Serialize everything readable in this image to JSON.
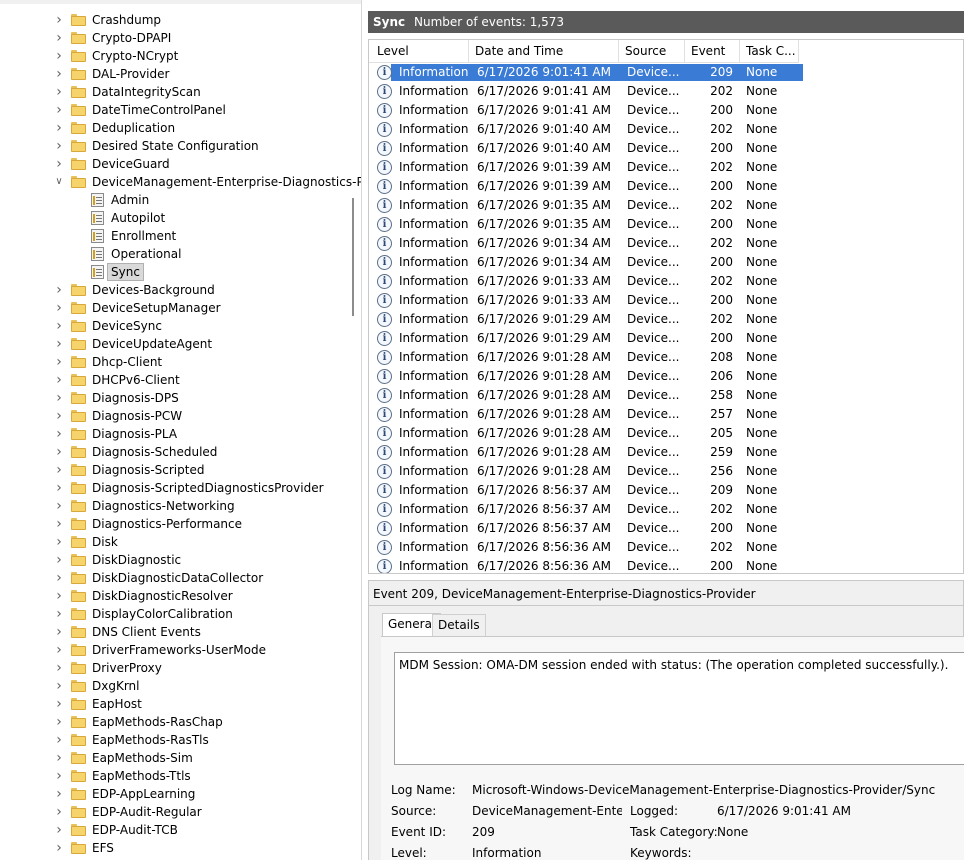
{
  "tree": {
    "items": [
      {
        "label": "Crashdump",
        "expanded": false
      },
      {
        "label": "Crypto-DPAPI",
        "expanded": false
      },
      {
        "label": "Crypto-NCrypt",
        "expanded": false
      },
      {
        "label": "DAL-Provider",
        "expanded": false
      },
      {
        "label": "DataIntegrityScan",
        "expanded": false
      },
      {
        "label": "DateTimeControlPanel",
        "expanded": false
      },
      {
        "label": "Deduplication",
        "expanded": false
      },
      {
        "label": "Desired State Configuration",
        "expanded": false
      },
      {
        "label": "DeviceGuard",
        "expanded": false
      },
      {
        "label": "DeviceManagement-Enterprise-Diagnostics-Pro",
        "expanded": true
      },
      {
        "label": "Devices-Background",
        "expanded": false
      },
      {
        "label": "DeviceSetupManager",
        "expanded": false
      },
      {
        "label": "DeviceSync",
        "expanded": false
      },
      {
        "label": "DeviceUpdateAgent",
        "expanded": false
      },
      {
        "label": "Dhcp-Client",
        "expanded": false
      },
      {
        "label": "DHCPv6-Client",
        "expanded": false
      },
      {
        "label": "Diagnosis-DPS",
        "expanded": false
      },
      {
        "label": "Diagnosis-PCW",
        "expanded": false
      },
      {
        "label": "Diagnosis-PLA",
        "expanded": false
      },
      {
        "label": "Diagnosis-Scheduled",
        "expanded": false
      },
      {
        "label": "Diagnosis-Scripted",
        "expanded": false
      },
      {
        "label": "Diagnosis-ScriptedDiagnosticsProvider",
        "expanded": false
      },
      {
        "label": "Diagnostics-Networking",
        "expanded": false
      },
      {
        "label": "Diagnostics-Performance",
        "expanded": false
      },
      {
        "label": "Disk",
        "expanded": false
      },
      {
        "label": "DiskDiagnostic",
        "expanded": false
      },
      {
        "label": "DiskDiagnosticDataCollector",
        "expanded": false
      },
      {
        "label": "DiskDiagnosticResolver",
        "expanded": false
      },
      {
        "label": "DisplayColorCalibration",
        "expanded": false
      },
      {
        "label": "DNS Client Events",
        "expanded": false
      },
      {
        "label": "DriverFrameworks-UserMode",
        "expanded": false
      },
      {
        "label": "DriverProxy",
        "expanded": false
      },
      {
        "label": "DxgKrnl",
        "expanded": false
      },
      {
        "label": "EapHost",
        "expanded": false
      },
      {
        "label": "EapMethods-RasChap",
        "expanded": false
      },
      {
        "label": "EapMethods-RasTls",
        "expanded": false
      },
      {
        "label": "EapMethods-Sim",
        "expanded": false
      },
      {
        "label": "EapMethods-Ttls",
        "expanded": false
      },
      {
        "label": "EDP-AppLearning",
        "expanded": false
      },
      {
        "label": "EDP-Audit-Regular",
        "expanded": false
      },
      {
        "label": "EDP-Audit-TCB",
        "expanded": false
      },
      {
        "label": "EFS",
        "expanded": false
      }
    ],
    "children": [
      "Admin",
      "Autopilot",
      "Enrollment",
      "Operational",
      "Sync"
    ],
    "selected_child": "Sync"
  },
  "header": {
    "title": "Sync",
    "count": "Number of events: 1,573"
  },
  "grid": {
    "columns": [
      "Level",
      "Date and Time",
      "Source",
      "Event ID",
      "Task C..."
    ],
    "rows": [
      [
        "Information",
        "6/17/2026 9:01:41 AM",
        "Device...",
        "209",
        "None"
      ],
      [
        "Information",
        "6/17/2026 9:01:41 AM",
        "Device...",
        "202",
        "None"
      ],
      [
        "Information",
        "6/17/2026 9:01:41 AM",
        "Device...",
        "200",
        "None"
      ],
      [
        "Information",
        "6/17/2026 9:01:40 AM",
        "Device...",
        "202",
        "None"
      ],
      [
        "Information",
        "6/17/2026 9:01:40 AM",
        "Device...",
        "200",
        "None"
      ],
      [
        "Information",
        "6/17/2026 9:01:39 AM",
        "Device...",
        "202",
        "None"
      ],
      [
        "Information",
        "6/17/2026 9:01:39 AM",
        "Device...",
        "200",
        "None"
      ],
      [
        "Information",
        "6/17/2026 9:01:35 AM",
        "Device...",
        "202",
        "None"
      ],
      [
        "Information",
        "6/17/2026 9:01:35 AM",
        "Device...",
        "200",
        "None"
      ],
      [
        "Information",
        "6/17/2026 9:01:34 AM",
        "Device...",
        "202",
        "None"
      ],
      [
        "Information",
        "6/17/2026 9:01:34 AM",
        "Device...",
        "200",
        "None"
      ],
      [
        "Information",
        "6/17/2026 9:01:33 AM",
        "Device...",
        "202",
        "None"
      ],
      [
        "Information",
        "6/17/2026 9:01:33 AM",
        "Device...",
        "200",
        "None"
      ],
      [
        "Information",
        "6/17/2026 9:01:29 AM",
        "Device...",
        "202",
        "None"
      ],
      [
        "Information",
        "6/17/2026 9:01:29 AM",
        "Device...",
        "200",
        "None"
      ],
      [
        "Information",
        "6/17/2026 9:01:28 AM",
        "Device...",
        "208",
        "None"
      ],
      [
        "Information",
        "6/17/2026 9:01:28 AM",
        "Device...",
        "206",
        "None"
      ],
      [
        "Information",
        "6/17/2026 9:01:28 AM",
        "Device...",
        "258",
        "None"
      ],
      [
        "Information",
        "6/17/2026 9:01:28 AM",
        "Device...",
        "257",
        "None"
      ],
      [
        "Information",
        "6/17/2026 9:01:28 AM",
        "Device...",
        "205",
        "None"
      ],
      [
        "Information",
        "6/17/2026 9:01:28 AM",
        "Device...",
        "259",
        "None"
      ],
      [
        "Information",
        "6/17/2026 9:01:28 AM",
        "Device...",
        "256",
        "None"
      ],
      [
        "Information",
        "6/17/2026 8:56:37 AM",
        "Device...",
        "209",
        "None"
      ],
      [
        "Information",
        "6/17/2026 8:56:37 AM",
        "Device...",
        "202",
        "None"
      ],
      [
        "Information",
        "6/17/2026 8:56:37 AM",
        "Device...",
        "200",
        "None"
      ],
      [
        "Information",
        "6/17/2026 8:56:36 AM",
        "Device...",
        "202",
        "None"
      ],
      [
        "Information",
        "6/17/2026 8:56:36 AM",
        "Device...",
        "200",
        "None"
      ]
    ],
    "selected_row": 0,
    "info_glyph": "i",
    "icon": "information-icon"
  },
  "detail": {
    "title": "Event 209, DeviceManagement-Enterprise-Diagnostics-Provider",
    "tabs": [
      "General",
      "Details"
    ],
    "active_tab": "General",
    "message": "MDM Session: OMA-DM session ended with status: (The operation completed successfully.).",
    "log_name_label": "Log Name:",
    "log_name": "Microsoft-Windows-DeviceManagement-Enterprise-Diagnostics-Provider/Sync",
    "source_label": "Source:",
    "source": "DeviceManagement-Enterpr",
    "logged_label": "Logged:",
    "logged": "6/17/2026 9:01:41 AM",
    "event_id_label": "Event ID:",
    "event_id": "209",
    "task_category_label": "Task Category:",
    "task_category": "None",
    "level_label": "Level:",
    "level": "Information",
    "keywords_label": "Keywords:",
    "keywords": ""
  },
  "colors": {
    "header_bg": "#5a5a5a",
    "selection": "#3a7bd5",
    "folder": "#f6d36b"
  }
}
